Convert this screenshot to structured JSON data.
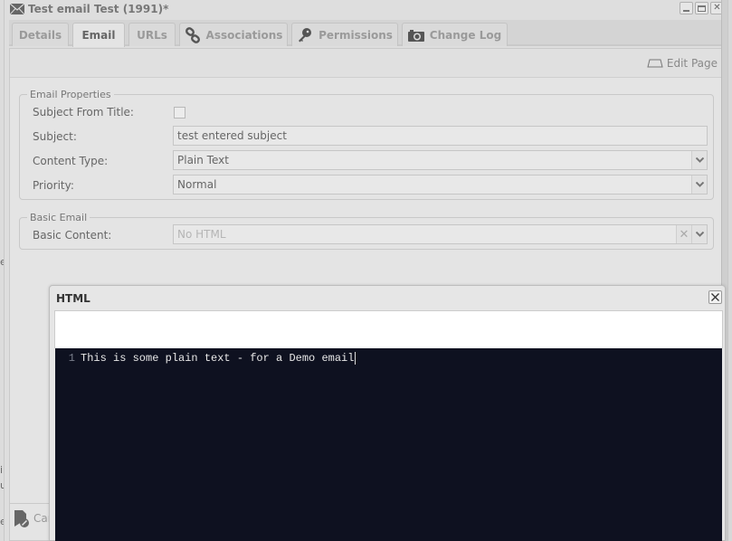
{
  "window": {
    "title": "Test email Test (1991)*",
    "icon": "envelope-icon",
    "controls": {
      "minimize": "minimize",
      "maximize": "maximize",
      "close": "close"
    }
  },
  "tabs": [
    {
      "label": "Details",
      "icon": null,
      "active": false
    },
    {
      "label": "Email",
      "icon": null,
      "active": true
    },
    {
      "label": "URLs",
      "icon": null,
      "active": false
    },
    {
      "label": "Associations",
      "icon": "link-icon",
      "active": false
    },
    {
      "label": "Permissions",
      "icon": "key-icon",
      "active": false
    },
    {
      "label": "Change Log",
      "icon": "camera-icon",
      "active": false
    }
  ],
  "toolbar": {
    "edit_page_label": "Edit Page"
  },
  "email_properties": {
    "legend": "Email Properties",
    "subject_from_title": {
      "label": "Subject From Title:",
      "checked": false
    },
    "subject": {
      "label": "Subject:",
      "value": "test entered subject"
    },
    "content_type": {
      "label": "Content Type:",
      "value": "Plain Text"
    },
    "priority": {
      "label": "Priority:",
      "value": "Normal"
    }
  },
  "basic_email": {
    "legend": "Basic Email",
    "basic_content": {
      "label": "Basic Content:",
      "placeholder": "No HTML"
    }
  },
  "footer": {
    "cancel_fragment": "Car"
  },
  "html_dialog": {
    "title": "HTML",
    "editor": {
      "lines": [
        {
          "number": "1",
          "text": "This is some plain text - for a Demo email"
        }
      ]
    }
  },
  "background_fragments": {
    "left_a": "e",
    "left_b": "i",
    "left_c": "u",
    "left_d": "e"
  }
}
